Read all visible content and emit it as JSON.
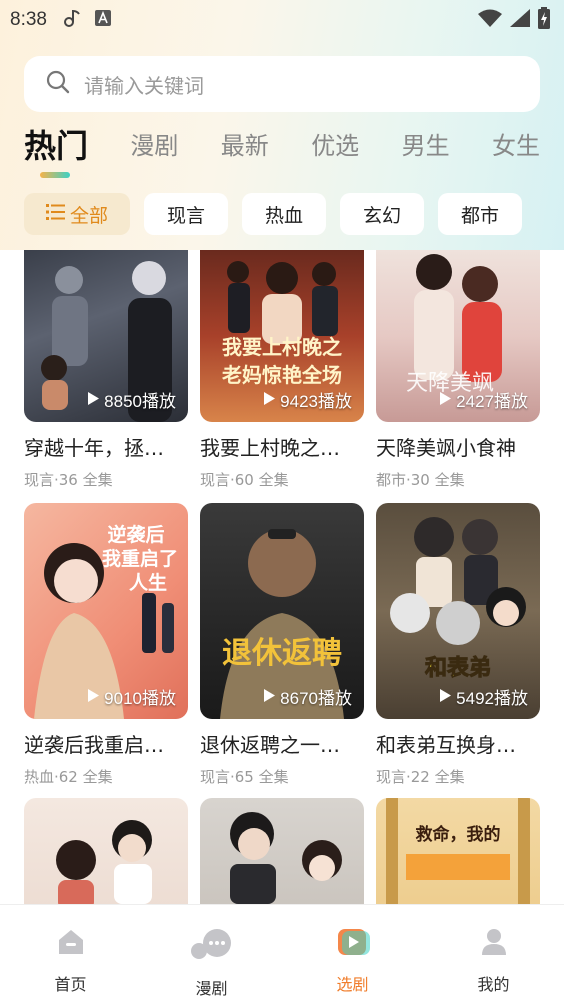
{
  "status_bar": {
    "time": "8:38"
  },
  "search": {
    "placeholder": "请输入关键词"
  },
  "tabs": [
    {
      "label": "热门",
      "active": true
    },
    {
      "label": "漫剧"
    },
    {
      "label": "最新"
    },
    {
      "label": "优选"
    },
    {
      "label": "男生"
    },
    {
      "label": "女生"
    }
  ],
  "chips": [
    {
      "label": "全部",
      "active": true
    },
    {
      "label": "现言"
    },
    {
      "label": "热血"
    },
    {
      "label": "玄幻"
    },
    {
      "label": "都市"
    }
  ],
  "dramas": [
    {
      "title": "穿越十年，拯…",
      "meta": "现言·36 全集",
      "plays": "8850播放"
    },
    {
      "title": "我要上村晚之…",
      "meta": "现言·60 全集",
      "plays": "9423播放"
    },
    {
      "title": "天降美飒小食神",
      "meta": "都市·30 全集",
      "plays": "2427播放"
    },
    {
      "title": "逆袭后我重启…",
      "meta": "热血·62 全集",
      "plays": "9010播放"
    },
    {
      "title": "退休返聘之一…",
      "meta": "现言·65 全集",
      "plays": "8670播放"
    },
    {
      "title": "和表弟互换身…",
      "meta": "现言·22 全集",
      "plays": "5492播放"
    },
    {
      "title": "",
      "meta": "",
      "plays": ""
    },
    {
      "title": "",
      "meta": "",
      "plays": ""
    },
    {
      "title": "",
      "meta": "",
      "plays": ""
    }
  ],
  "nav": [
    {
      "label": "首页"
    },
    {
      "label": "漫剧"
    },
    {
      "label": "选剧",
      "active": true
    },
    {
      "label": "我的"
    }
  ],
  "colors": {
    "accent": "#f07c2a",
    "chip_active_bg": "#f6e9cf"
  }
}
